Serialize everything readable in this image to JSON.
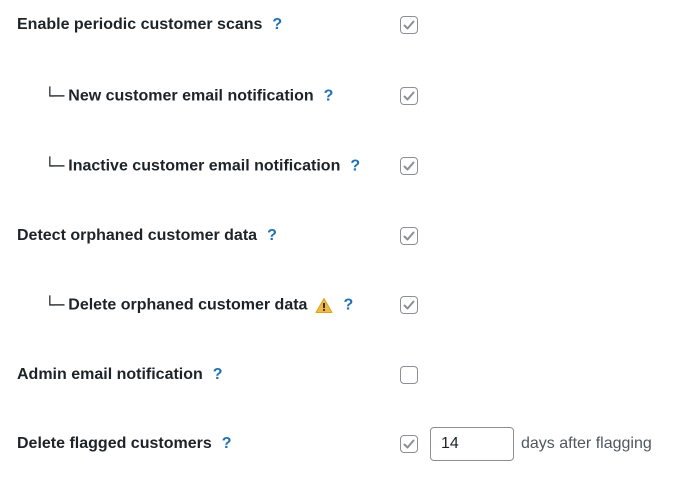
{
  "settings": [
    {
      "label": "Enable periodic customer scans",
      "help": "?",
      "checked": true,
      "child": false,
      "warning": false
    },
    {
      "label": "New customer email notification",
      "help": "?",
      "checked": true,
      "child": true,
      "warning": false
    },
    {
      "label": "Inactive customer email notification",
      "help": "?",
      "checked": true,
      "child": true,
      "warning": false
    },
    {
      "label": "Detect orphaned customer data",
      "help": "?",
      "checked": true,
      "child": false,
      "warning": false
    },
    {
      "label": "Delete orphaned customer data",
      "help": "?",
      "checked": true,
      "child": true,
      "warning": true
    },
    {
      "label": "Admin email notification",
      "help": "?",
      "checked": false,
      "child": false,
      "warning": false
    },
    {
      "label": "Delete flagged customers",
      "help": "?",
      "checked": true,
      "child": false,
      "warning": false,
      "input_value": "14",
      "suffix": "days after flagging"
    }
  ],
  "tree_glyph": "└─",
  "colors": {
    "help": "#2271b1",
    "checkmark": "#8c8f94",
    "warning": "#f0b849",
    "text": "#1d2327"
  }
}
